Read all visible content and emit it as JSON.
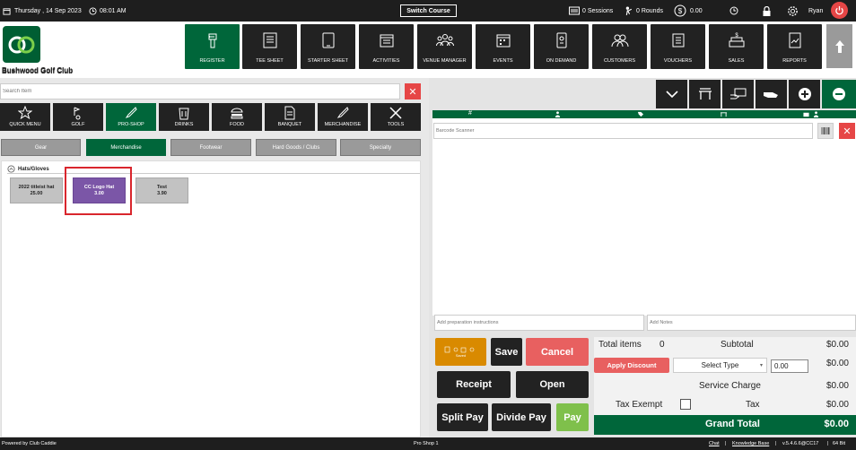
{
  "topbar": {
    "date": "Thursday ,  14 Sep 2023",
    "time": "08:01 AM",
    "switch_course": "Switch Course",
    "sessions": "0 Sessions",
    "rounds": "0 Rounds",
    "balance": "0.00",
    "user": "Ryan"
  },
  "club_name": "Bushwood Golf Club",
  "nav": [
    "REGISTER",
    "TEE SHEET",
    "STARTER SHEET",
    "ACTIVITIES",
    "VENUE MANAGER",
    "EVENTS",
    "ON DEMAND",
    "CUSTOMERS",
    "VOUCHERS",
    "SALES",
    "REPORTS"
  ],
  "search_placeholder": "Search Item",
  "categories": [
    "QUICK MENU",
    "GOLF",
    "PRO-SHOP",
    "DRINKS",
    "FOOD",
    "BANQUET",
    "MERCHANDISE",
    "TOOLS"
  ],
  "subcategories": [
    "Gear",
    "Merchandise",
    "Footwear",
    "Hard Goods / Clubs",
    "Specialty"
  ],
  "group_label": "Hats/Gloves",
  "items": [
    {
      "name": "2022 titleist hat",
      "price": "25.00"
    },
    {
      "name": "CC Logo Hat",
      "price": "3.00"
    },
    {
      "name": "Test",
      "price": "3.90"
    }
  ],
  "barcode_placeholder": "Barcode Scanner",
  "prep_placeholder": "Add preparation instructions",
  "notes_placeholder": "Add Notes",
  "buttons": {
    "save": "Save",
    "cancel": "Cancel",
    "receipt": "Receipt",
    "open": "Open",
    "split_pay": "Split Pay",
    "divide_pay": "Divide Pay",
    "pay": "Pay",
    "apply_discount": "Apply Discount",
    "select_type": "Select Type",
    "saved_label": "Saved"
  },
  "totals": {
    "total_items_label": "Total items",
    "total_items": "0",
    "subtotal_label": "Subtotal",
    "subtotal": "$0.00",
    "discount_value": "0.00",
    "discount_amount": "$0.00",
    "service_charge_label": "Service Charge",
    "service_charge": "$0.00",
    "tax_exempt_label": "Tax Exempt",
    "tax_label": "Tax",
    "tax": "$0.00",
    "grand_total_label": "Grand Total",
    "grand_total": "$0.00"
  },
  "footer": {
    "powered": "Powered by Club Caddie",
    "location": "Pro Shop 1",
    "chat": "Chat",
    "sep": "|",
    "kb": "Knowledge Base",
    "version": "v.5.4.6.6@CC17",
    "bits": "64 Bit"
  },
  "colors": {
    "green": "#00663a",
    "red": "#e64646",
    "purple": "#7b56a7",
    "orange": "#d98a00",
    "dark": "#222222"
  }
}
